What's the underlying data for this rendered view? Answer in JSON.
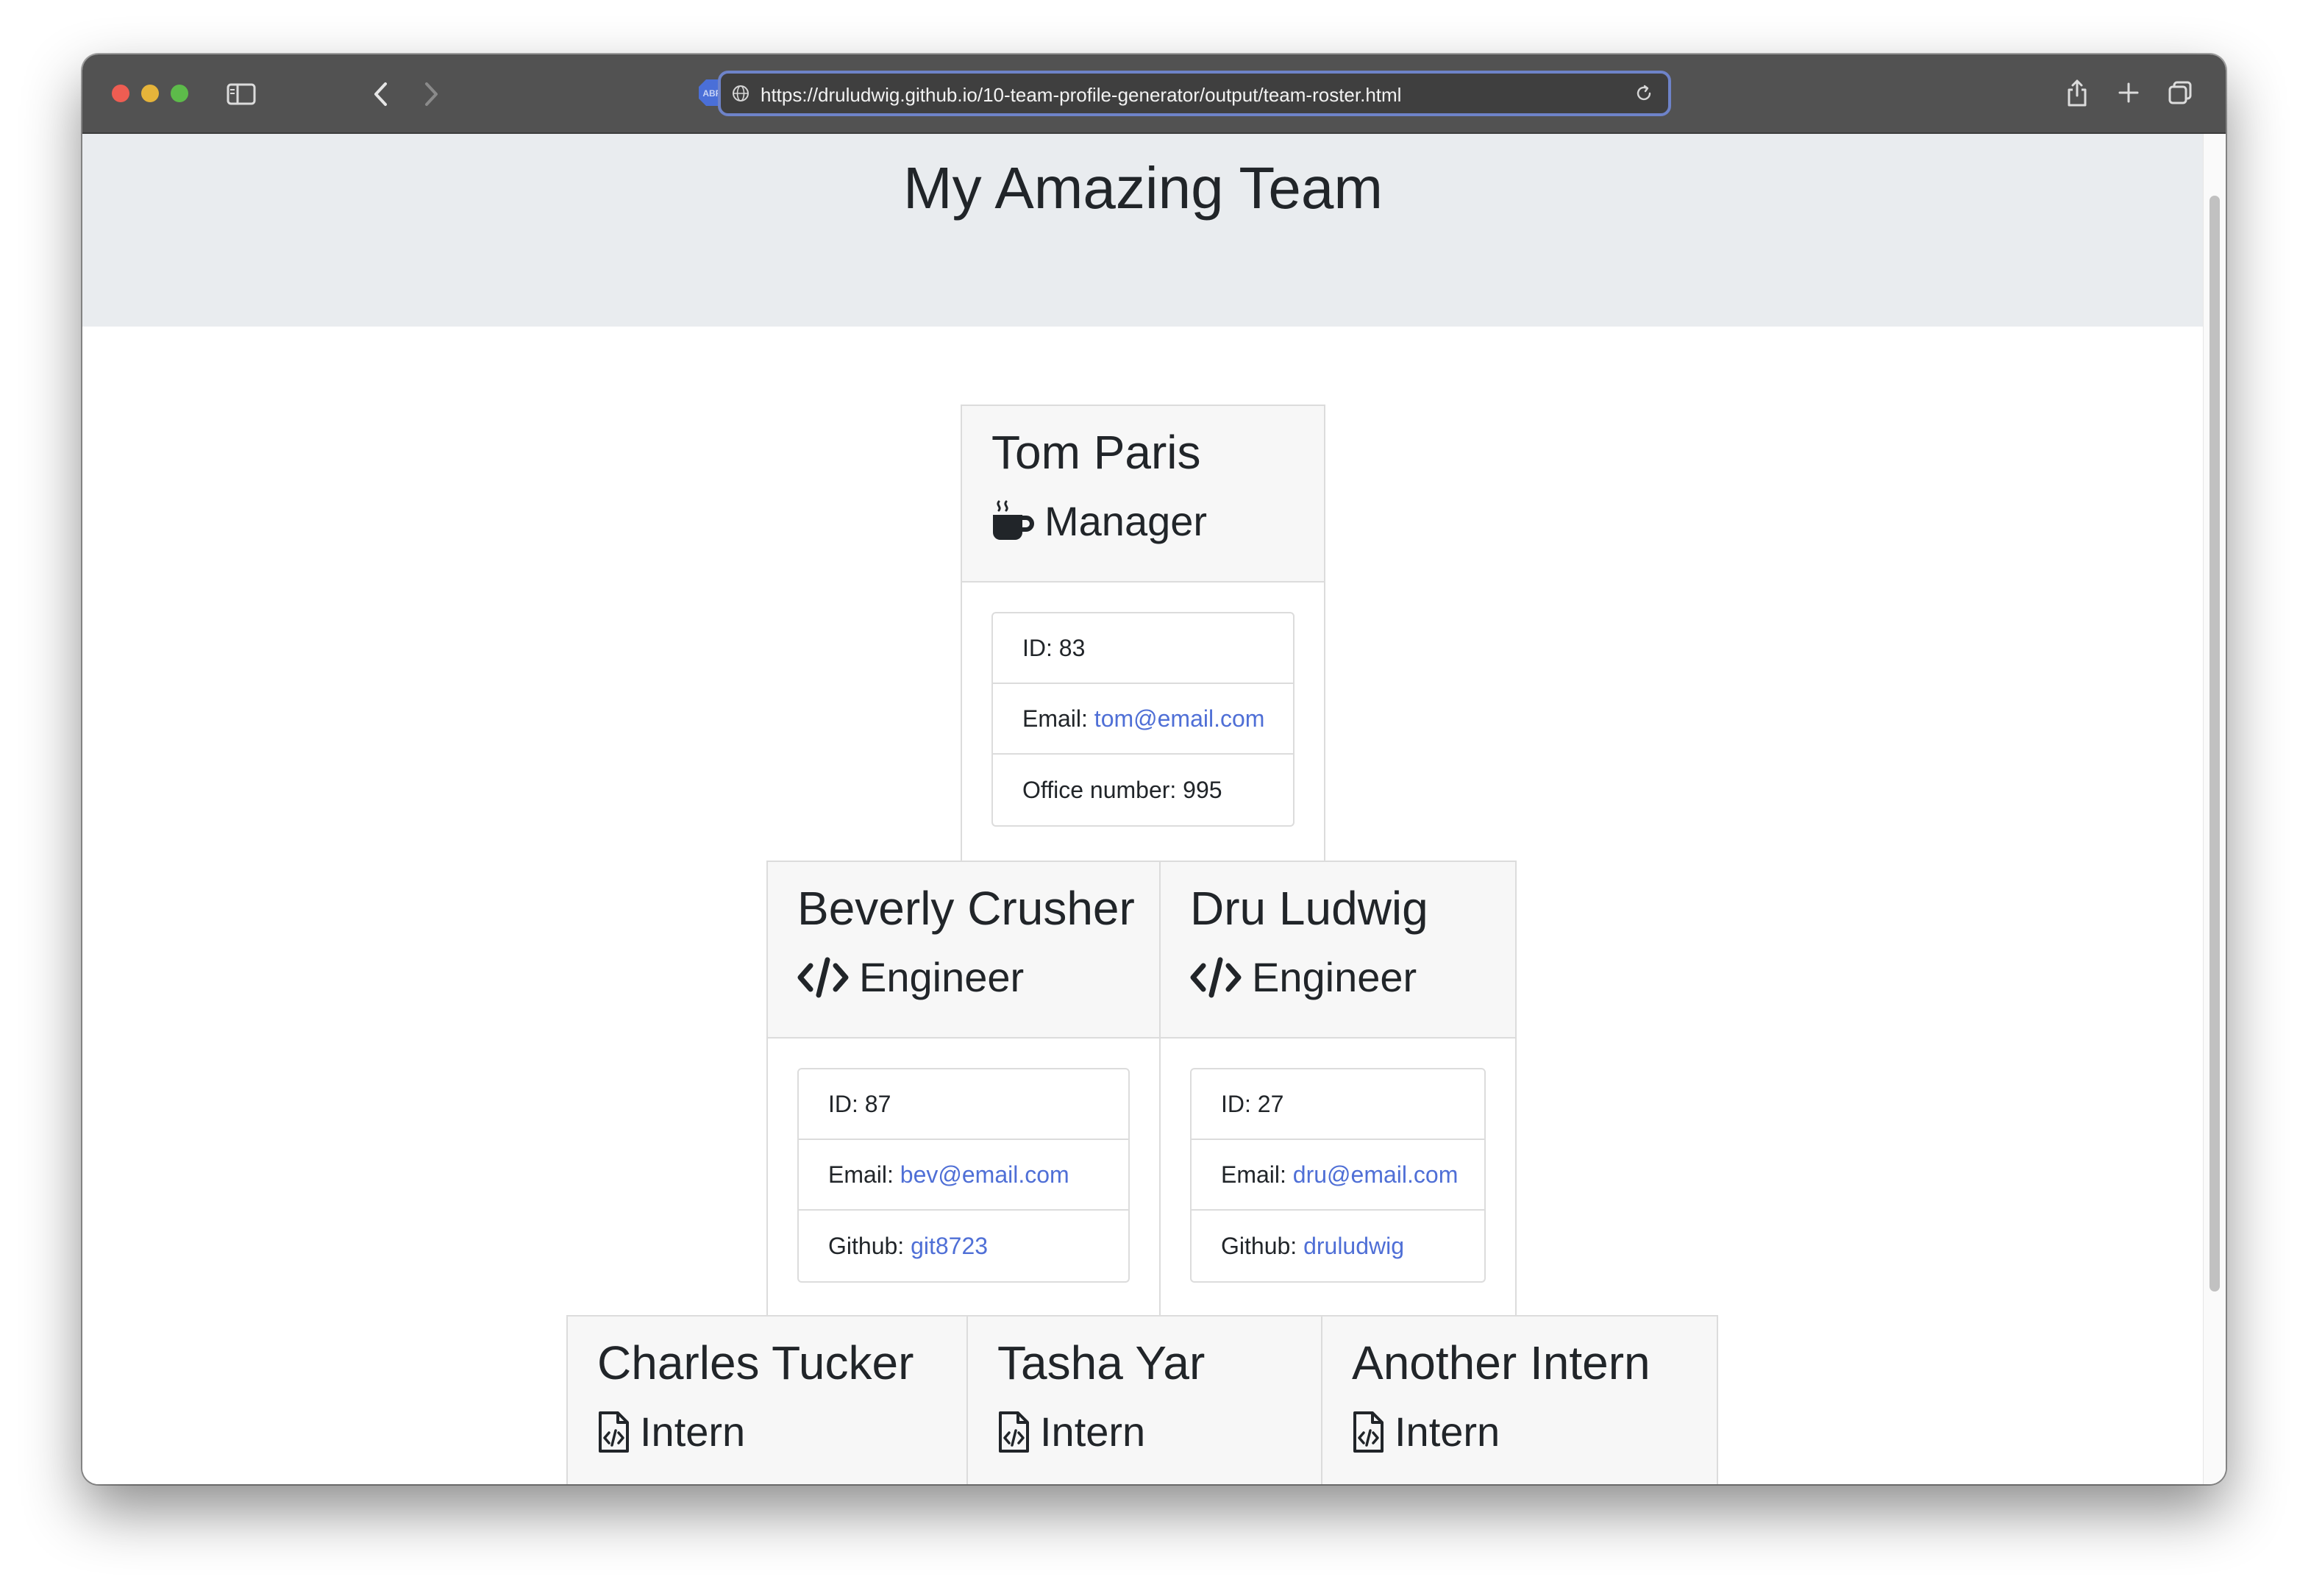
{
  "browser": {
    "url": "https://druludwig.github.io/10-team-profile-generator/output/team-roster.html",
    "extension_badge": "ABP"
  },
  "page": {
    "title": "My Amazing Team"
  },
  "colors": {
    "link": "#4f6fd6",
    "jumbotron_bg": "#e9ecef",
    "card_header_bg": "#f7f7f7",
    "toolbar_bg": "#525252"
  },
  "team": {
    "manager": {
      "name": "Tom Paris",
      "role": "Manager",
      "icon": "coffee-mug-icon",
      "id_label": "ID:",
      "id": "83",
      "email_label": "Email:",
      "email": "tom@email.com",
      "office_label": "Office number:",
      "office": "995"
    },
    "engineers": [
      {
        "name": "Beverly Crusher",
        "role": "Engineer",
        "icon": "code-icon",
        "id_label": "ID:",
        "id": "87",
        "email_label": "Email:",
        "email": "bev@email.com",
        "github_label": "Github:",
        "github": "git8723"
      },
      {
        "name": "Dru Ludwig",
        "role": "Engineer",
        "icon": "code-icon",
        "id_label": "ID:",
        "id": "27",
        "email_label": "Email:",
        "email": "dru@email.com",
        "github_label": "Github:",
        "github": "druludwig"
      }
    ],
    "interns": [
      {
        "name": "Charles Tucker",
        "role": "Intern",
        "icon": "file-code-icon"
      },
      {
        "name": "Tasha Yar",
        "role": "Intern",
        "icon": "file-code-icon"
      },
      {
        "name": "Another Intern",
        "role": "Intern",
        "icon": "file-code-icon"
      }
    ]
  }
}
